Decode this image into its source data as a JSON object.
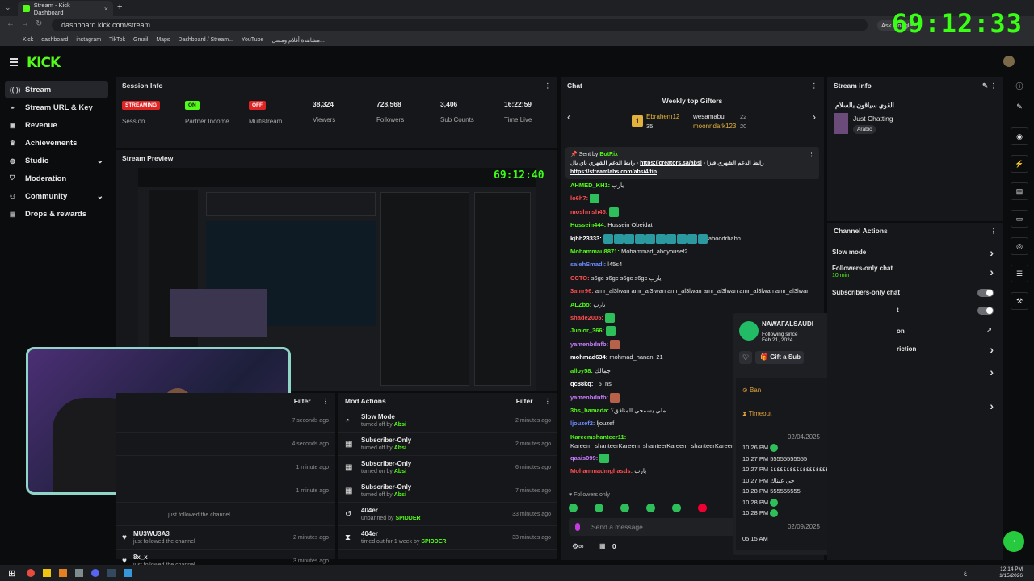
{
  "browser": {
    "tab_title": "Stream - Kick Dashboard",
    "url": "dashboard.kick.com/stream",
    "ask": "Ask Google",
    "bookmarks": [
      "Kick",
      "dashboard",
      "instagram",
      "TikTok",
      "Gmail",
      "Maps",
      "Dashboard / Stream...",
      "YouTube",
      "مشاهدة أفلام ومسل..."
    ]
  },
  "overlay_timer": "69:12:33",
  "brand": "KICK",
  "sidebar": [
    {
      "label": "Stream",
      "icon": "broadcast-icon",
      "active": true
    },
    {
      "label": "Stream URL & Key",
      "icon": "link-icon"
    },
    {
      "label": "Revenue",
      "icon": "revenue-icon"
    },
    {
      "label": "Achievements",
      "icon": "trophy-icon"
    },
    {
      "label": "Studio",
      "icon": "palette-icon",
      "chevron": true
    },
    {
      "label": "Moderation",
      "icon": "shield-icon"
    },
    {
      "label": "Community",
      "icon": "people-icon",
      "chevron": true
    },
    {
      "label": "Drops & rewards",
      "icon": "gift-icon"
    }
  ],
  "session": {
    "title": "Session Info",
    "stats": [
      {
        "badge": "STREAMING",
        "label": "Session"
      },
      {
        "badge": "ON",
        "label": "Partner Income"
      },
      {
        "badge": "OFF",
        "label": "Multistream"
      },
      {
        "value": "38,324",
        "label": "Viewers"
      },
      {
        "value": "728,568",
        "label": "Followers"
      },
      {
        "value": "3,406",
        "label": "Sub Counts"
      },
      {
        "value": "16:22:59",
        "label": "Time Live"
      }
    ]
  },
  "preview": {
    "title": "Stream Preview",
    "inner_timer": "69:12:40"
  },
  "activity": {
    "filter": "Filter",
    "rows": [
      {
        "time": "7 seconds ago"
      },
      {
        "time": "4 seconds ago"
      },
      {
        "time": "1 minute ago"
      },
      {
        "time": "1 minute ago"
      },
      {
        "name": "",
        "sub": "just followed the channel",
        "time": ""
      },
      {
        "name": "MU3WU3A3",
        "sub": "just followed the channel",
        "time": "2 minutes ago"
      },
      {
        "name": "8x_x",
        "sub": "just followed the channel",
        "time": "3 minutes ago"
      }
    ]
  },
  "mod": {
    "title": "Mod Actions",
    "filter": "Filter",
    "rows": [
      {
        "t": "Slow Mode",
        "pre": "turned off by",
        "by": "Absi",
        "time": "2 minutes ago",
        "icon": "slow-mode-icon"
      },
      {
        "t": "Subscriber-Only",
        "pre": "turned off by",
        "by": "Absi",
        "time": "2 minutes ago",
        "icon": "gift-box-icon"
      },
      {
        "t": "Subscriber-Only",
        "pre": "turned on by",
        "by": "Absi",
        "time": "6 minutes ago",
        "icon": "gift-box-icon"
      },
      {
        "t": "Subscriber-Only",
        "pre": "turned off by",
        "by": "Absi",
        "time": "7 minutes ago",
        "icon": "gift-box-icon"
      },
      {
        "t": "404er",
        "pre": "unbanned by",
        "by": "SPIDDER",
        "time": "33 minutes ago",
        "icon": "undo-icon"
      },
      {
        "t": "404er",
        "pre": "timed out for 1 week by",
        "by": "SPIDDER",
        "time": "33 minutes ago",
        "icon": "hourglass-icon"
      }
    ]
  },
  "chat": {
    "title": "Chat",
    "gifters_title": "Weekly top Gifters",
    "g1_name": "Ebrahem12",
    "g1_count": "35",
    "g2_name": "wesamabu",
    "g2_count": "22",
    "g3_name": "moonndark123",
    "g3_count": "20",
    "pinned_by": "Sent by",
    "pinned_user": "BotRix",
    "pinned_text": "رابط الدعم الشهري باي بال - ",
    "pinned_link1": "https://creators.sa/absi",
    "pinned_text2": "- رابط الدعم الشهري فيزا",
    "pinned_link2": "https://streamlabs.com/absi4/tip",
    "messages": [
      {
        "u": "AHMED_KH1:",
        "c": "#53fc18",
        "t": "يارب"
      },
      {
        "u": "lo6h7:",
        "c": "#ff4f4f",
        "t": ""
      },
      {
        "u": "moshmsh45:",
        "c": "#ff4f4f",
        "t": ""
      },
      {
        "u": "Hussein444:",
        "c": "#53fc18",
        "t": "Hussein Obeidat"
      },
      {
        "u": "kjhh23333:",
        "c": "#fff",
        "t": "aboodrbabh"
      },
      {
        "u": "Mohammau8871:",
        "c": "#53fc18",
        "t": "Mohammad_aboyousef2"
      },
      {
        "u": "salehSmadi:",
        "c": "#6c8cff",
        "t": "l45s4"
      },
      {
        "u": "CCTO:",
        "c": "#ff4f4f",
        "t": "s6gc s6gc s6gc s6gc يارب"
      },
      {
        "u": "3amr96:",
        "c": "#ff4f4f",
        "t": "amr_al3lwan amr_al3lwan amr_al3lwan amr_al3lwan amr_al3lwan amr_al3lwan"
      },
      {
        "u": "ALZbo:",
        "c": "#53fc18",
        "t": "يارب"
      },
      {
        "u": "shade2005:",
        "c": "#ff4f4f",
        "t": ""
      },
      {
        "u": "Junior_366:",
        "c": "#53fc18",
        "t": ""
      },
      {
        "u": "yamenbdnfb:",
        "c": "#c77dff",
        "t": ""
      },
      {
        "u": "mohmad634:",
        "c": "#fff",
        "t": "mohmad_hanani 21"
      },
      {
        "u": "alloy58:",
        "c": "#53fc18",
        "t": "جمالك"
      },
      {
        "u": "qc88kq:",
        "c": "#fff",
        "t": "_5_ns"
      },
      {
        "u": "yamenbdnfb:",
        "c": "#c77dff",
        "t": ""
      },
      {
        "u": "3bs_hamada:",
        "c": "#53fc18",
        "t": "ملي يسمحي المنافق؟"
      },
      {
        "u": "ljouzef2:",
        "c": "#6c8cff",
        "t": "ljouzef"
      },
      {
        "u": "Kareemshanteer11:",
        "c": "#53fc18",
        "t": "Kareem_shanteerKareem_shanteerKareem_shanteerKareem_shanteer"
      },
      {
        "u": "qaais099:",
        "c": "#c77dff",
        "t": ""
      },
      {
        "u": "Mohammadmghasds:",
        "c": "#ff4f4f",
        "t": "يارب"
      }
    ],
    "followers_only": "Followers only",
    "placeholder": "Send a message",
    "bottom_count": "0"
  },
  "user_card": {
    "name": "NAWAFALSAUDI",
    "following_label": "Following since",
    "following_date": "Feb 21, 2024",
    "gift": "Gift a Sub",
    "ban": "Ban",
    "timeout": "Timeout",
    "date1": "02/04/2025",
    "date2": "02/09/2025",
    "log": [
      {
        "time": "10:26 PM",
        "text": ""
      },
      {
        "time": "10:27 PM",
        "text": "55555555555"
      },
      {
        "time": "10:27 PM",
        "text": "٤٤٤٤٤٤٤٤٤٤٤٤٤٤٤٤٤٤٤٤٤٤٤٤٤٤٤"
      },
      {
        "time": "10:27 PM",
        "text": "حي عيناك"
      },
      {
        "time": "10:28 PM",
        "text": "555555555"
      },
      {
        "time": "10:28 PM",
        "text": ""
      },
      {
        "time": "10:28 PM",
        "text": ""
      }
    ],
    "last_time": "05:15 AM"
  },
  "stream_info": {
    "title": "Stream info",
    "stream_title": "القوي سياقون بالسلام",
    "category": "Just Chatting",
    "tag": "Arabic"
  },
  "channel_actions": {
    "title": "Channel Actions",
    "items": [
      {
        "label": "Slow mode",
        "kind": "chevron"
      },
      {
        "label": "Followers-only chat",
        "sub": "10 min",
        "kind": "chevron"
      },
      {
        "label": "Subscribers-only chat",
        "kind": "toggle"
      },
      {
        "label": "t",
        "kind": "toggle"
      },
      {
        "label": "on",
        "kind": "external"
      },
      {
        "label": "riction",
        "kind": "chevron"
      },
      {
        "label": "",
        "kind": "chevron"
      },
      {
        "label": "",
        "kind": "chevron"
      }
    ]
  },
  "taskbar": {
    "time": "12:14 PM",
    "date": "1/15/2026",
    "lang": "ع"
  },
  "colors": {
    "accent": "#53fc18",
    "panel": "#16171a",
    "bg": "#0b0c0e"
  }
}
